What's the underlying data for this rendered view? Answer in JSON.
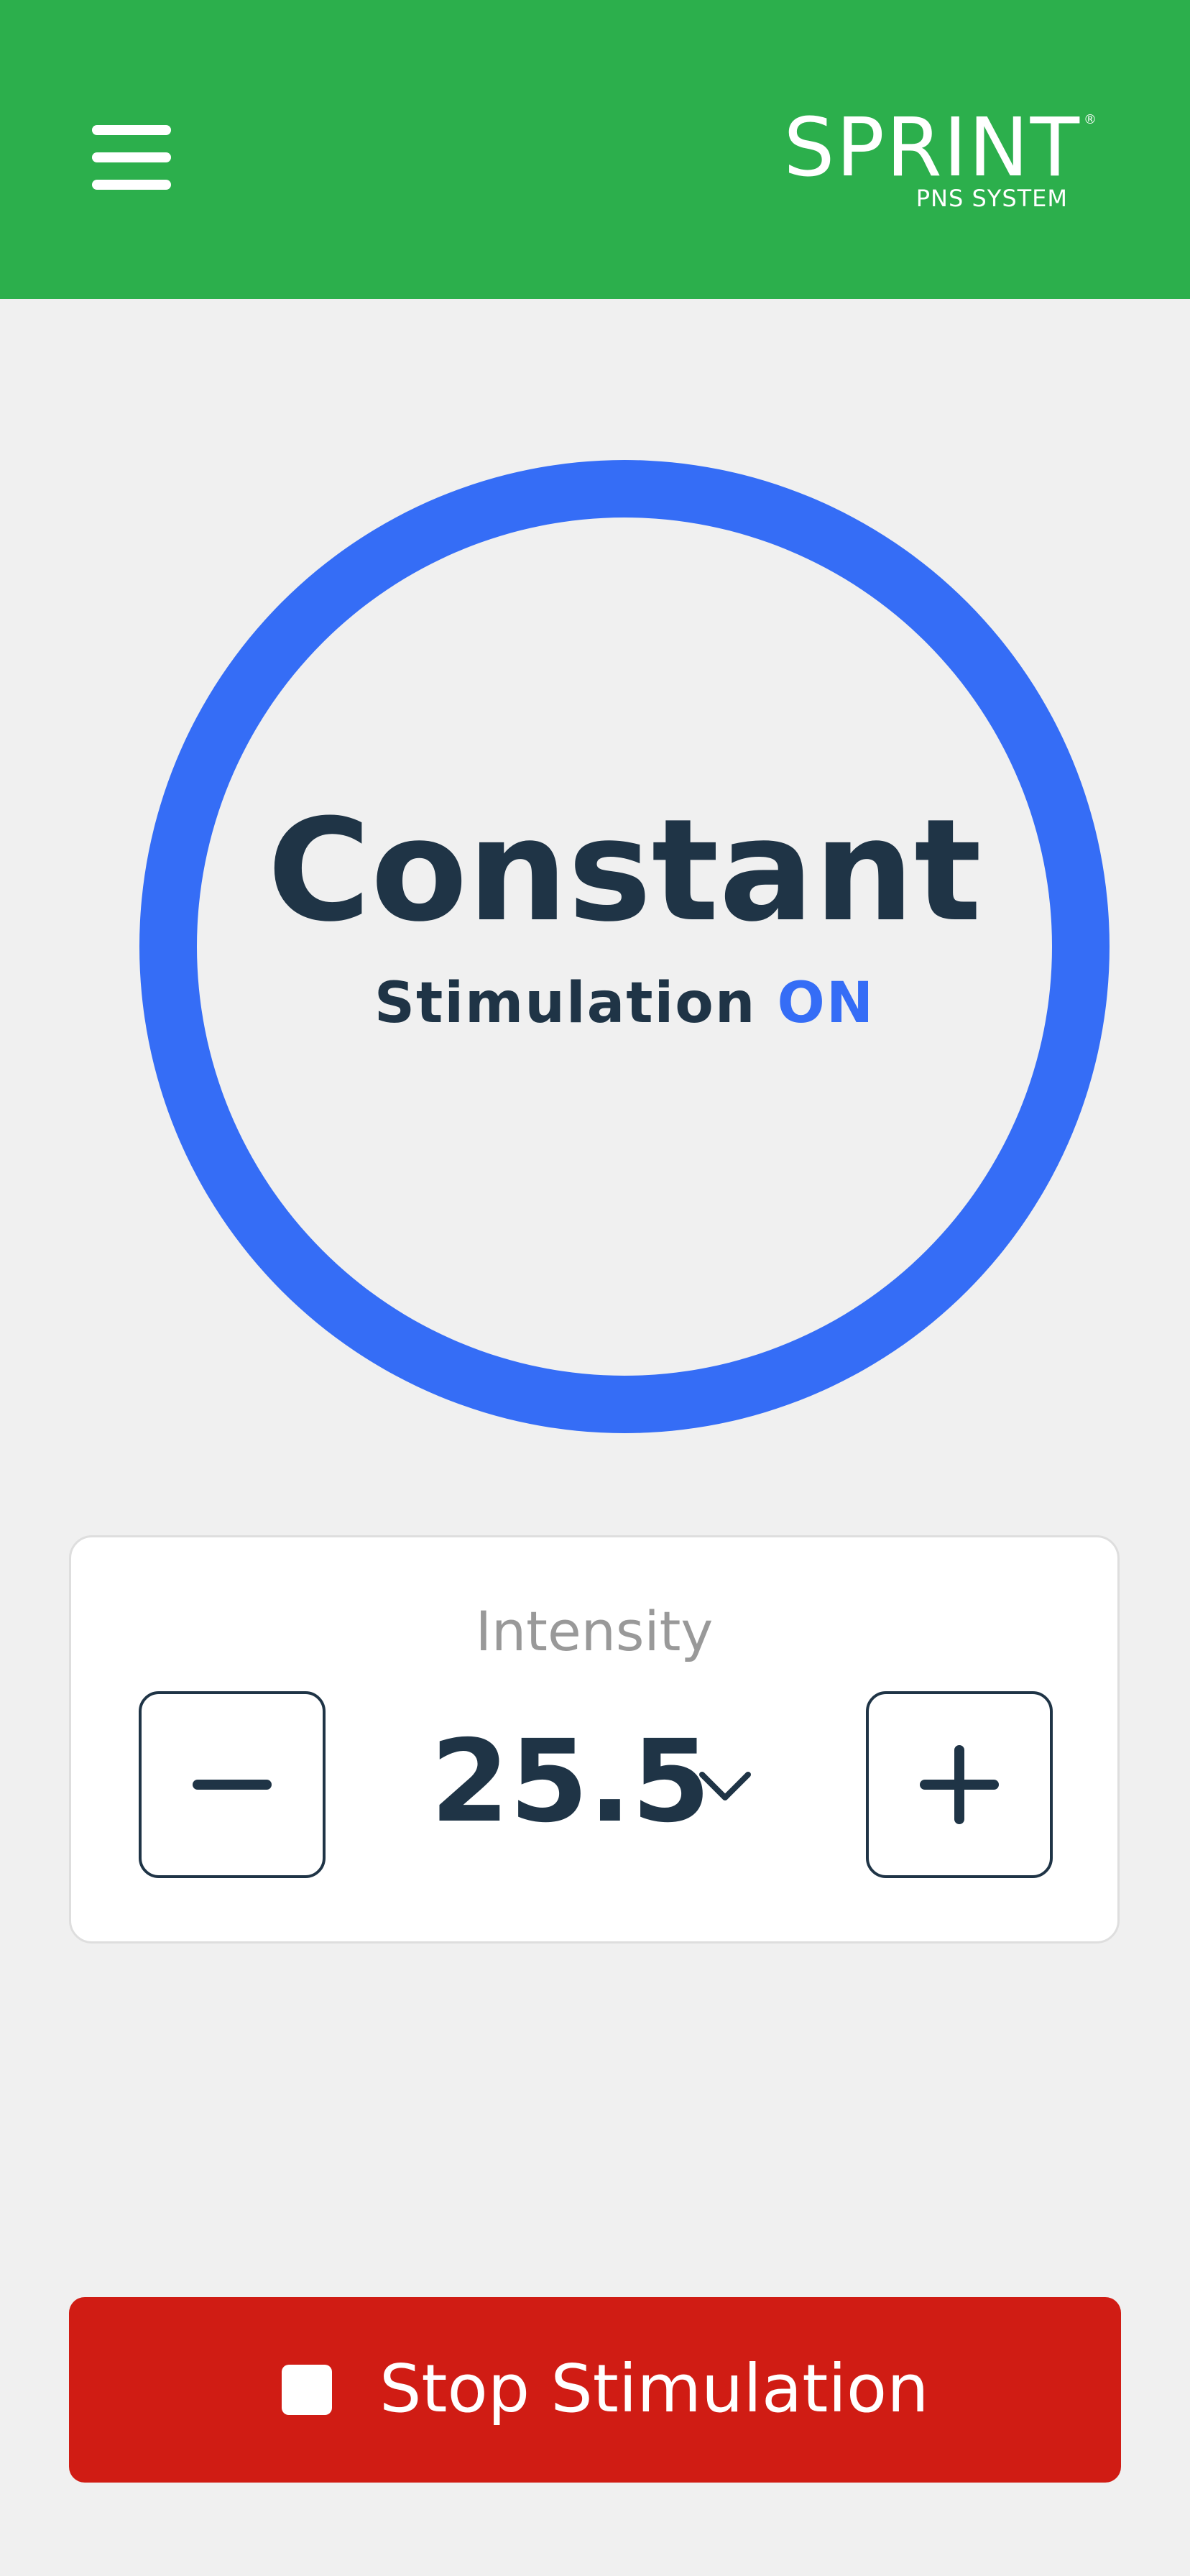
{
  "header": {
    "menu_icon": "hamburger-menu-icon",
    "logo_text": "SPRINT",
    "logo_registered": "®",
    "logo_subtitle": "PNS SYSTEM",
    "background_color": "#2caf4c"
  },
  "status": {
    "mode": "Constant",
    "stimulation_label": "Stimulation",
    "stimulation_state": "ON",
    "ring_color": "#356df6"
  },
  "intensity": {
    "label": "Intensity",
    "value": "25.5",
    "decrease_icon": "minus-icon",
    "increase_icon": "plus-icon",
    "dropdown_icon": "chevron-down-icon"
  },
  "stop_button": {
    "label": "Stop Stimulation",
    "icon": "stop-square-icon",
    "color": "#d01c14"
  }
}
